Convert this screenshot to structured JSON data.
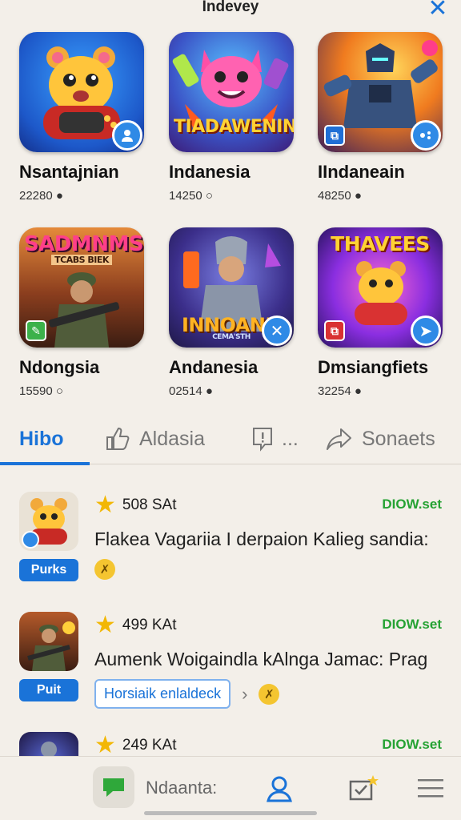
{
  "header": {
    "title": "Indevey",
    "close_icon": "x-close-icon"
  },
  "games": [
    {
      "name": "Nsantajnian",
      "stat": "22280",
      "stat_icon": "drop-icon",
      "art": "hamster-controller",
      "badge_icon": "user-icon"
    },
    {
      "name": "Indanesia",
      "stat": "14250",
      "stat_icon": "circle-icon",
      "art": "pink-creature",
      "banner": "TIADAWENINS"
    },
    {
      "name": "IIndaneain",
      "stat": "48250",
      "stat_icon": "drop-icon",
      "art": "robot-hero",
      "badge_icon": "gamepad-icon"
    },
    {
      "name": "Ndongsia",
      "stat": "15590",
      "stat_icon": "circle-icon",
      "art": "soldier",
      "banner": "SADMNMS",
      "sub_banner": "TCABS BIEK"
    },
    {
      "name": "Andanesia",
      "stat": "02514",
      "stat_icon": "drop-icon",
      "art": "knight",
      "banner": "INNOANN",
      "sub_banner": "CEMA'STH",
      "badge_icon": "x-icon"
    },
    {
      "name": "Dmsiangfiets",
      "stat": "32254",
      "stat_icon": "drop-icon",
      "art": "hamster-purple",
      "banner": "THAVEES",
      "badge_icon": "send-icon"
    }
  ],
  "tabs": [
    {
      "label": "Hibo",
      "active": true
    },
    {
      "label": "Aldasia",
      "icon": "thumb-up-icon"
    },
    {
      "label": "...",
      "icon": "chat-alert-icon"
    },
    {
      "label": "Sonaets",
      "icon": "share-arrow-icon"
    }
  ],
  "list": [
    {
      "rating": "508 SAt",
      "status": "DIOW.set",
      "desc": "Flakea Vagariia I derpaion Kalieg sandia:",
      "pill": "Purks",
      "art": "hamster-controller"
    },
    {
      "rating": "499 KAt",
      "status": "DIOW.set",
      "desc": "Aumenk Woigaindla kAlnga Jamac: Prag",
      "pill": "Puit",
      "action": "Horsiaik enlaldeck",
      "art": "soldier"
    },
    {
      "rating": "249 KAt",
      "status": "DIOW.set",
      "art": "robot-hero"
    }
  ],
  "bottomnav": {
    "label": "Ndaanta:",
    "items": [
      "chat-bubble-icon",
      "profile-icon",
      "inbox-star-icon",
      "menu-icon"
    ]
  },
  "colors": {
    "accent": "#1a73d8",
    "status_green": "#25a233",
    "bg": "#f3efe9"
  }
}
